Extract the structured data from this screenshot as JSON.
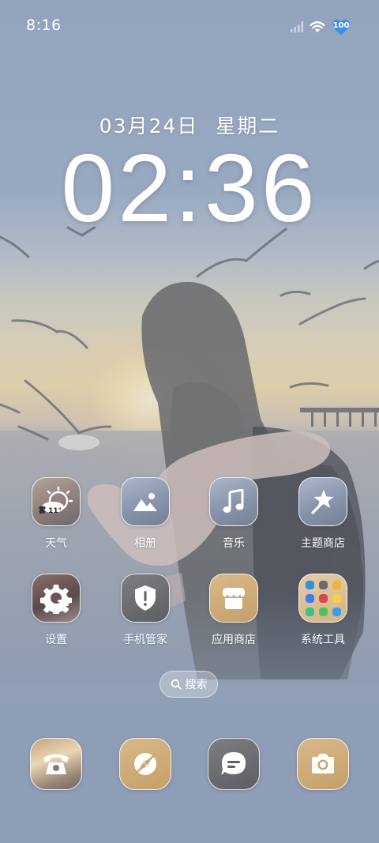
{
  "status_bar": {
    "time": "8:16",
    "signal_icon": "cellular-signal-icon",
    "wifi_icon": "wifi-icon",
    "battery_level": "100"
  },
  "lockscreen_clock": {
    "date": "03月24日",
    "weekday": "星期二",
    "time": "02:36"
  },
  "home_apps": [
    {
      "label": "天气",
      "icon": "weather-fog-icon",
      "badge": "雾 11°"
    },
    {
      "label": "相册",
      "icon": "gallery-icon"
    },
    {
      "label": "音乐",
      "icon": "music-note-icon"
    },
    {
      "label": "主题商店",
      "icon": "theme-store-icon"
    },
    {
      "label": "设置",
      "icon": "settings-gear-icon"
    },
    {
      "label": "手机管家",
      "icon": "security-shield-icon"
    },
    {
      "label": "应用商店",
      "icon": "app-store-icon"
    },
    {
      "label": "系统工具",
      "icon": "system-tools-folder-icon"
    }
  ],
  "search": {
    "label": "搜索",
    "icon": "search-icon"
  },
  "dock": [
    {
      "icon": "phone-icon"
    },
    {
      "icon": "compass-icon"
    },
    {
      "icon": "messages-icon"
    },
    {
      "icon": "camera-icon"
    }
  ],
  "colors": {
    "wallpaper_tint": "#8fa0b9",
    "gold_icon": "#c9a56f",
    "dark_icon": "#64656a"
  }
}
